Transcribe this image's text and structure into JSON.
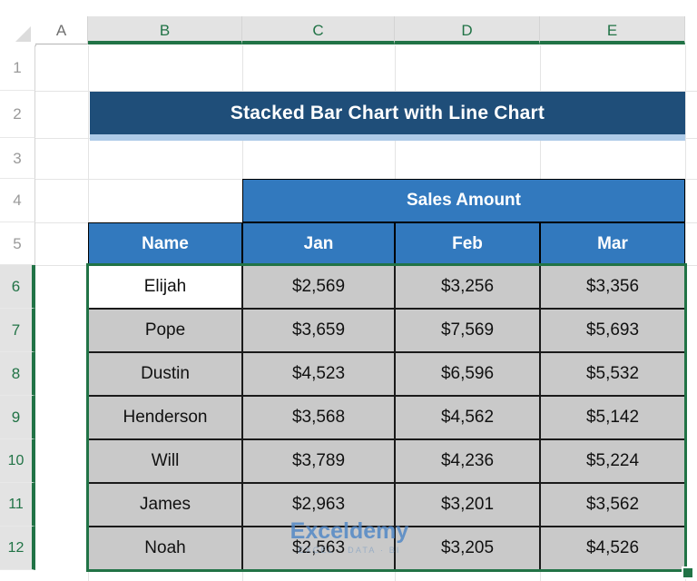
{
  "app": {
    "type": "spreadsheet",
    "select_all_label": "",
    "colors": {
      "title_banner": "#1f4e79",
      "title_understrip": "#aecbe8",
      "table_header": "#3279be",
      "selected_cell_fill": "#c9c9c9",
      "active_cell_fill": "#ffffff",
      "selection_border": "#217346",
      "header_selected_text": "#217346",
      "header_text": "#6f6f6f"
    }
  },
  "column_headers": [
    {
      "label": "A",
      "selected": false
    },
    {
      "label": "B",
      "selected": true
    },
    {
      "label": "C",
      "selected": true
    },
    {
      "label": "D",
      "selected": true
    },
    {
      "label": "E",
      "selected": true
    }
  ],
  "row_headers": [
    {
      "label": "1",
      "selected": false
    },
    {
      "label": "2",
      "selected": false
    },
    {
      "label": "3",
      "selected": false
    },
    {
      "label": "4",
      "selected": false
    },
    {
      "label": "5",
      "selected": false
    },
    {
      "label": "6",
      "selected": true
    },
    {
      "label": "7",
      "selected": true
    },
    {
      "label": "8",
      "selected": true
    },
    {
      "label": "9",
      "selected": true
    },
    {
      "label": "10",
      "selected": true
    },
    {
      "label": "11",
      "selected": true
    },
    {
      "label": "12",
      "selected": true
    }
  ],
  "title": {
    "text": "Stacked Bar Chart with Line Chart"
  },
  "table": {
    "group_header": "Sales Amount",
    "columns": [
      "Name",
      "Jan",
      "Feb",
      "Mar"
    ],
    "rows": [
      {
        "name": "Elijah",
        "jan": "$2,569",
        "feb": "$3,256",
        "mar": "$3,356",
        "active": true
      },
      {
        "name": "Pope",
        "jan": "$3,659",
        "feb": "$7,569",
        "mar": "$5,693",
        "active": false
      },
      {
        "name": "Dustin",
        "jan": "$4,523",
        "feb": "$6,596",
        "mar": "$5,532",
        "active": false
      },
      {
        "name": "Henderson",
        "jan": "$3,568",
        "feb": "$4,562",
        "mar": "$5,142",
        "active": false
      },
      {
        "name": "Will",
        "jan": "$3,789",
        "feb": "$4,236",
        "mar": "$5,224",
        "active": false
      },
      {
        "name": "James",
        "jan": "$2,963",
        "feb": "$3,201",
        "mar": "$3,562",
        "active": false
      },
      {
        "name": "Noah",
        "jan": "$2,563",
        "feb": "$3,205",
        "mar": "$4,526",
        "active": false
      }
    ]
  },
  "watermark": {
    "main": "Exceldemy",
    "sub": "EXCEL · DATA · BI"
  },
  "chart_data": {
    "type": "table",
    "title": "Stacked Bar Chart with Line Chart",
    "categories": [
      "Elijah",
      "Pope",
      "Dustin",
      "Henderson",
      "Will",
      "James",
      "Noah"
    ],
    "series": [
      {
        "name": "Jan",
        "values": [
          2569,
          3659,
          4523,
          3568,
          3789,
          2963,
          2563
        ]
      },
      {
        "name": "Feb",
        "values": [
          3256,
          7569,
          6596,
          4562,
          4236,
          3201,
          3205
        ]
      },
      {
        "name": "Mar",
        "values": [
          3356,
          5693,
          5532,
          5142,
          5224,
          3562,
          4526
        ]
      }
    ],
    "xlabel": "Name",
    "ylabel": "Sales Amount"
  }
}
